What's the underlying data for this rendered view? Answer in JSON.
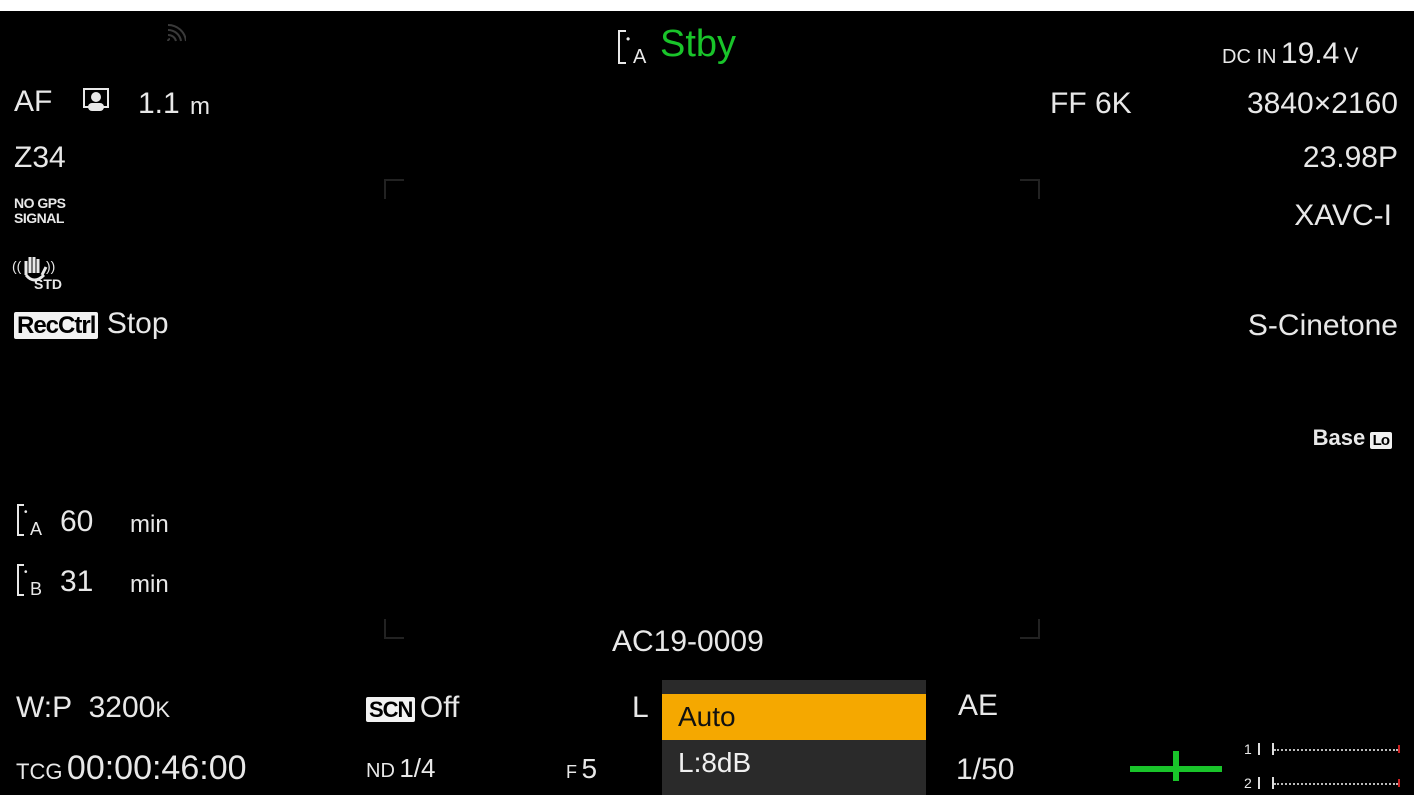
{
  "top": {
    "media_slot": "A",
    "status": "Stby",
    "power_source": "DC IN",
    "voltage": "19.4",
    "voltage_unit": "V"
  },
  "focus": {
    "mode": "AF",
    "distance": "1.1",
    "unit": "m"
  },
  "zoom": "Z34",
  "gps": {
    "line1": "NO GPS",
    "line2": "SIGNAL"
  },
  "stabilizer": {
    "label": "STD"
  },
  "rec_ctrl": {
    "badge": "RecCtrl",
    "state": "Stop"
  },
  "media": [
    {
      "slot": "A",
      "remaining": "60",
      "unit": "min"
    },
    {
      "slot": "B",
      "remaining": "31",
      "unit": "min"
    }
  ],
  "imager": "FF 6K",
  "resolution": "3840×2160",
  "frame_rate": "23.98P",
  "codec": "XAVC-I",
  "look": "S-Cinetone",
  "iso": {
    "label": "Base",
    "badge": "Lo"
  },
  "clip_name": "AC19-0009",
  "white_balance": {
    "preset": "W:P",
    "value": "3200",
    "unit": "K"
  },
  "scene_file": {
    "badge": "SCN",
    "state": "Off"
  },
  "gain_prefix": "L",
  "ae": "AE",
  "timecode": {
    "label": "TCG",
    "value": "00:00:46:00"
  },
  "nd": {
    "label": "ND",
    "value": "1/4"
  },
  "iris": {
    "label": "F",
    "value": "5"
  },
  "shutter": "1/50",
  "audio": {
    "ch1": "1",
    "ch2": "2"
  },
  "dropdown": {
    "options": [
      "Auto",
      "L:8dB"
    ],
    "selected": "Auto"
  },
  "colors": {
    "status_green": "#19c42a",
    "highlight": "#f5a800"
  }
}
